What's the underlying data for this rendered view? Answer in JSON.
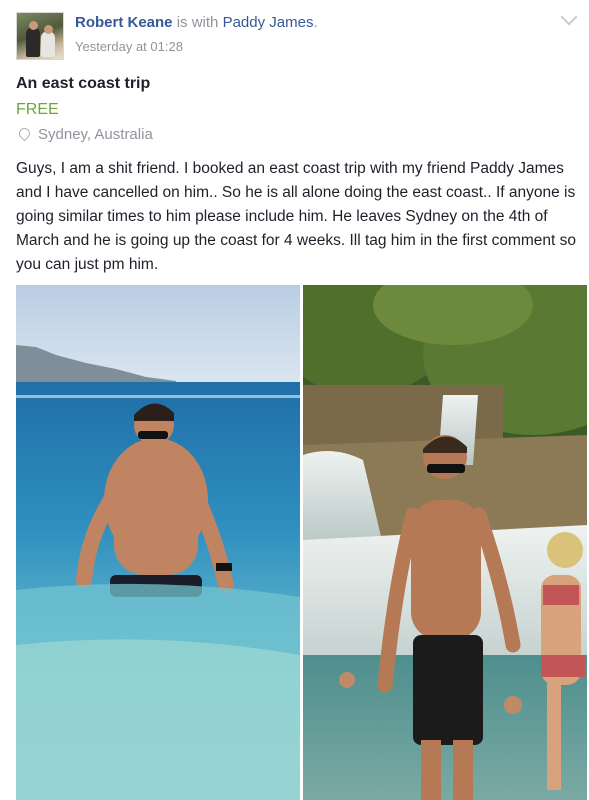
{
  "post": {
    "author": "Robert Keane",
    "with_text": "is with",
    "tagged": "Paddy James",
    "tagged_suffix": ".",
    "timestamp": "Yesterday at 01:28"
  },
  "listing": {
    "title": "An east coast trip",
    "price": "FREE",
    "location": "Sydney, Australia"
  },
  "body": "Guys, I am a shit friend. I booked an east coast trip with my friend Paddy James and I have cancelled on him.. So he is all alone doing the east coast.. If anyone is going similar times to him please include him. He leaves Sydney on the 4th of March and he is going up the coast for 4 weeks. Ill tag him in the first comment so you can just pm him.",
  "icons": {
    "menu": "chevron-down-icon",
    "location": "map-pin-icon"
  },
  "colors": {
    "link": "#365899",
    "price": "#6ca53a",
    "meta": "#90949c"
  }
}
